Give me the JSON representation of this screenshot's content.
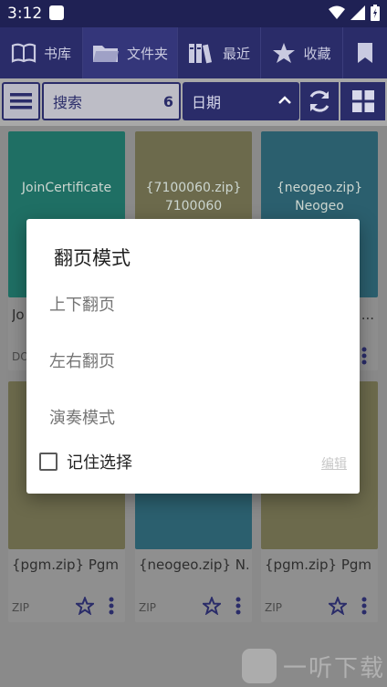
{
  "status_bar": {
    "time": "3:12"
  },
  "nav_tabs": [
    {
      "label": "书库",
      "icon": "book-icon"
    },
    {
      "label": "文件夹",
      "icon": "folder-icon"
    },
    {
      "label": "最近",
      "icon": "books-shelf-icon"
    },
    {
      "label": "收藏",
      "icon": "star-icon"
    },
    {
      "label": "",
      "icon": "bookmark-icon"
    }
  ],
  "toolbar": {
    "search_label": "搜索",
    "search_count": "6",
    "sort_label": "日期"
  },
  "cards": [
    {
      "cover_text": "JoinCertificate",
      "cover_text2": "",
      "title": "Jo",
      "format": "DO"
    },
    {
      "cover_text": "{7100060.zip}",
      "cover_text2": "7100060",
      "title": "",
      "format": ""
    },
    {
      "cover_text": "{neogeo.zip}",
      "cover_text2": "Neogeo",
      "title": "...",
      "format": ""
    },
    {
      "cover_text": "",
      "cover_text2": "",
      "title": "{pgm.zip} Pgm",
      "format": "ZIP"
    },
    {
      "cover_text": "",
      "cover_text2": "",
      "title": "{neogeo.zip} N...",
      "format": "ZIP"
    },
    {
      "cover_text": "",
      "cover_text2": "",
      "title": "{pgm.zip} Pgm",
      "format": "ZIP"
    }
  ],
  "dialog": {
    "title": "翻页模式",
    "options": [
      "上下翻页",
      "左右翻页",
      "演奏模式"
    ],
    "remember_label": "记住选择",
    "edit_label": "编辑"
  },
  "watermark": {
    "text": "一听下载",
    "logo_char": "听"
  },
  "colors": {
    "nav_bg": "#2a2c69",
    "cover_teal": "#1f6f64",
    "cover_olive": "#6c6a4c",
    "cover_blue": "#2b5f6e"
  }
}
